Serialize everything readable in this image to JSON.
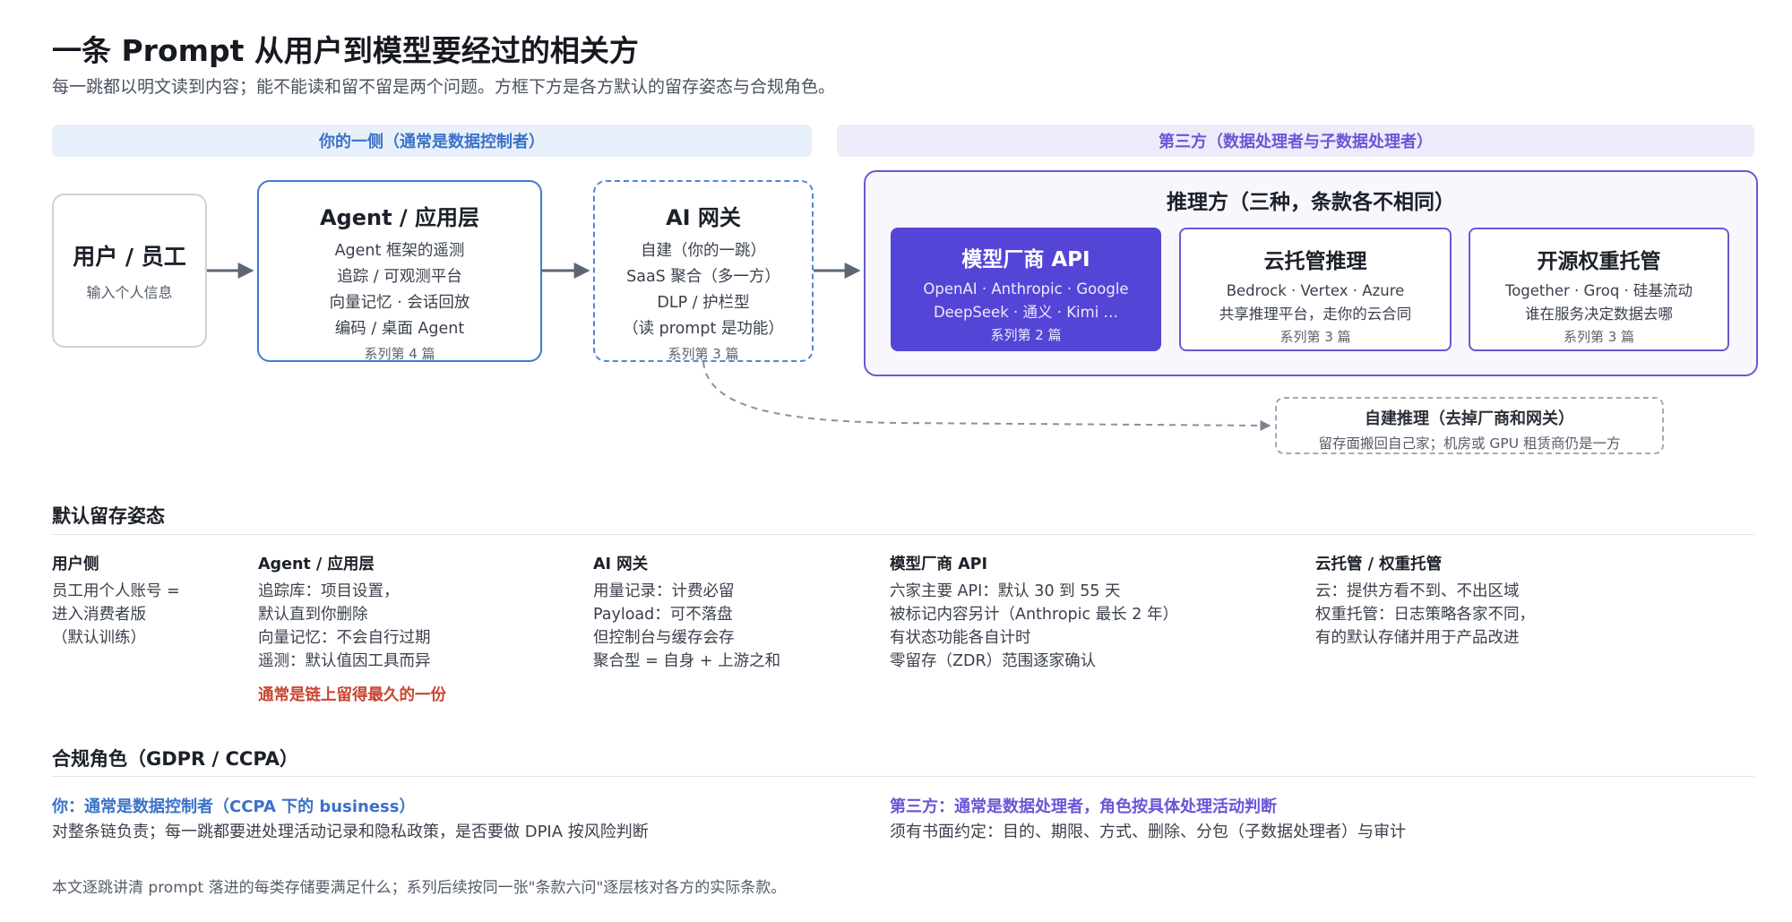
{
  "header": {
    "title": "一条 Prompt 从用户到模型要经过的相关方",
    "subtitle": "每一跳都以明文读到内容；能不能读和留不留是两个问题。方框下方是各方默认的留存姿态与合规角色。"
  },
  "bands": {
    "left": "你的一侧（通常是数据控制者）",
    "right": "第三方（数据处理者与子数据处理者）"
  },
  "flow": {
    "user": {
      "title": "用户 / 员工",
      "note": "输入个人信息"
    },
    "agent": {
      "title": "Agent / 应用层",
      "lines": [
        "Agent 框架的遥测",
        "追踪 / 可观测平台",
        "向量记忆 · 会话回放",
        "编码 / 桌面 Agent"
      ],
      "series": "系列第 4 篇"
    },
    "gateway": {
      "title": "AI 网关",
      "lines": [
        "自建（你的一跳）",
        "SaaS 聚合（多一方）",
        "DLP / 护栏型",
        "（读 prompt 是功能）"
      ],
      "series": "系列第 3 篇"
    },
    "inference": {
      "title": "推理方（三种，条款各不相同）",
      "api": {
        "title": "模型厂商 API",
        "lines": [
          "OpenAI · Anthropic · Google",
          "DeepSeek · 通义 · Kimi …"
        ],
        "series": "系列第 2 篇"
      },
      "cloud": {
        "title": "云托管推理",
        "lines": [
          "Bedrock · Vertex · Azure",
          "共享推理平台，走你的云合同"
        ],
        "series": "系列第 3 篇"
      },
      "opensource": {
        "title": "开源权重托管",
        "lines": [
          "Together · Groq · 硅基流动",
          "谁在服务决定数据去哪"
        ],
        "series": "系列第 3 篇"
      }
    },
    "selfhost": {
      "title": "自建推理（去掉厂商和网关）",
      "note": "留存面搬回自己家；机房或 GPU 租赁商仍是一方"
    }
  },
  "retention": {
    "heading": "默认留存姿态",
    "columns": [
      {
        "title": "用户侧",
        "lines": [
          "员工用个人账号 =",
          "进入消费者版",
          "（默认训练）"
        ]
      },
      {
        "title": "Agent / 应用层",
        "lines": [
          "追踪库：项目设置，",
          "默认直到你删除",
          "向量记忆：不会自行过期",
          "遥测：默认值因工具而异"
        ],
        "highlight": "通常是链上留得最久的一份"
      },
      {
        "title": "AI 网关",
        "lines": [
          "用量记录：计费必留",
          "Payload：可不落盘",
          "但控制台与缓存会存",
          "聚合型 = 自身 + 上游之和"
        ]
      },
      {
        "title": "模型厂商 API",
        "lines": [
          "六家主要 API：默认 30 到 55 天",
          "被标记内容另计（Anthropic 最长 2 年）",
          "有状态功能各自计时",
          "零留存（ZDR）范围逐家确认"
        ]
      },
      {
        "title": "云托管 / 权重托管",
        "lines": [
          "云：提供方看不到、不出区域",
          "权重托管：日志策略各家不同，",
          "有的默认存储并用于产品改进"
        ]
      }
    ]
  },
  "compliance": {
    "heading": "合规角色（GDPR / CCPA）",
    "you_heading": "你：通常是数据控制者（CCPA 下的 business）",
    "you_text": "对整条链负责；每一跳都要进处理活动记录和隐私政策，是否要做 DPIA 按风险判断",
    "third_heading": "第三方：通常是数据处理者，角色按具体处理活动判断",
    "third_text": "须有书面约定：目的、期限、方式、删除、分包（子数据处理者）与审计"
  },
  "footer": "本文逐跳讲清 prompt 落进的每类存储要满足什么；系列后续按同一张\"条款六问\"逐层核对各方的实际条款。",
  "colors": {
    "blue": "#3f7bd2",
    "purple": "#6a57d4",
    "api_fill": "#5545d6",
    "red": "#c8452f",
    "arrow": "#5c6675"
  }
}
